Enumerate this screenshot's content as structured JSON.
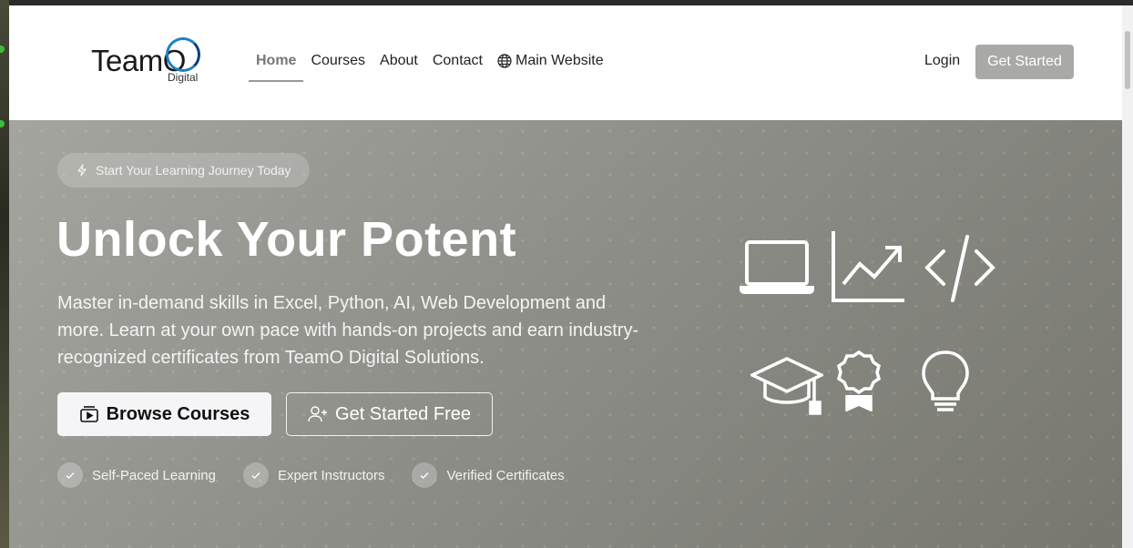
{
  "brand": {
    "name": "TeamO",
    "sub": "Digital"
  },
  "nav": {
    "items": [
      {
        "label": "Home"
      },
      {
        "label": "Courses"
      },
      {
        "label": "About"
      },
      {
        "label": "Contact"
      },
      {
        "label": "Main Website"
      }
    ],
    "login": "Login",
    "get_started": "Get Started"
  },
  "hero": {
    "badge": "Start Your Learning Journey Today",
    "headline": "Unlock Your Potent",
    "description": "Master in-demand skills in Excel, Python, AI, Web Development and more. Learn at your own pace with hands-on projects and earn industry-recognized certificates from TeamO Digital Solutions.",
    "browse_label": "Browse Courses",
    "free_label": "Get Started Free",
    "features": [
      "Self-Paced Learning",
      "Expert Instructors",
      "Verified Certificates"
    ],
    "icons": [
      "laptop-icon",
      "chart-line-icon",
      "code-icon",
      "graduation-cap-icon",
      "award-icon",
      "lightbulb-icon"
    ]
  },
  "colors": {
    "nav_button": "#a9a9a7",
    "hero_bg": "#8d8d88",
    "logo_blue": "#1e7fc3"
  }
}
